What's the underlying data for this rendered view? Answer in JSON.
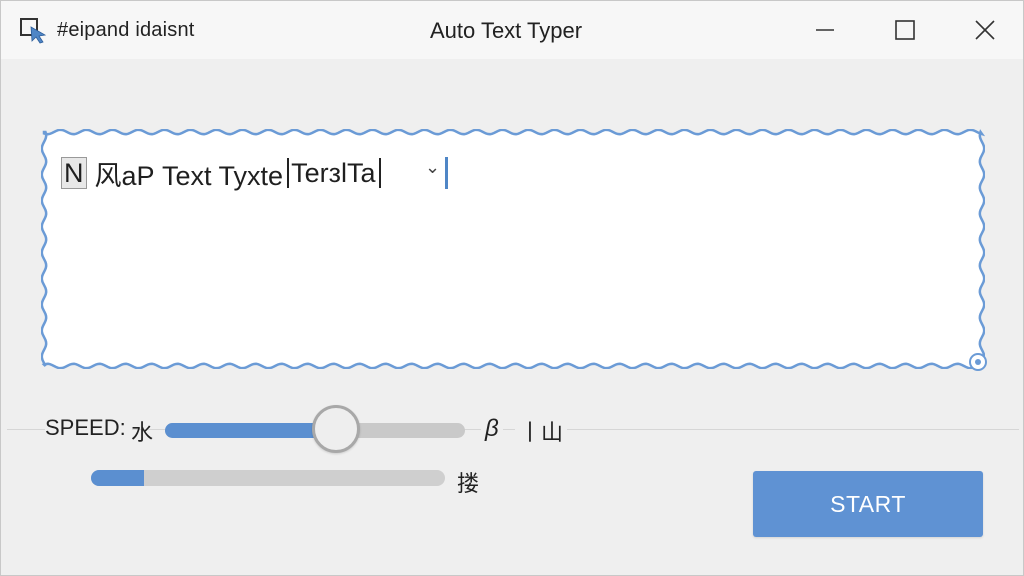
{
  "window": {
    "app_name": "#eipand idaisnt",
    "title": "Auto Text Typer",
    "controls": {
      "minimize": "minimize",
      "maximize": "maximize",
      "close": "close"
    }
  },
  "editor": {
    "first_char": "N",
    "text": "风аР Text Tyxte",
    "text_after_caret": "TerзlTa",
    "chevron": "⌄",
    "border_color": "#6b9bd6"
  },
  "speed": {
    "label": "SPEED:",
    "min_label": "水",
    "max_label": "β",
    "unit_label": "丨山",
    "value_fraction": 0.53
  },
  "progress": {
    "label": "搂",
    "value_fraction": 0.15
  },
  "start_button": {
    "label": "START"
  },
  "colors": {
    "accent": "#5b8fd0",
    "button": "#5f92d3",
    "background": "#efefef"
  }
}
